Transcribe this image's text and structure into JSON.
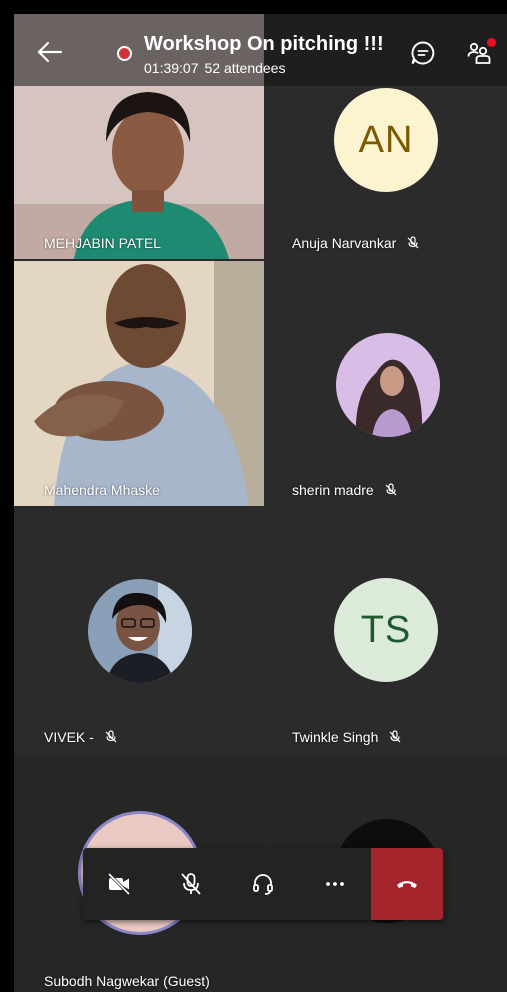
{
  "header": {
    "title": "Workshop On pitching !!!",
    "duration": "01:39:07",
    "attendees": "52 attendees"
  },
  "participants": [
    {
      "name": "MEHJABIN PATEL",
      "type": "video",
      "muted": false
    },
    {
      "name": "Anuja Narvankar",
      "type": "initials",
      "initials": "AN",
      "bg": "#fcf3cf",
      "fg": "#7a5a00",
      "muted": true
    },
    {
      "name": "Mahendra Mhaske",
      "type": "video",
      "muted": false
    },
    {
      "name": "sherin madre",
      "type": "photo",
      "muted": true
    },
    {
      "name": "VIVEK -",
      "type": "photo",
      "muted": true
    },
    {
      "name": "Twinkle  Singh",
      "type": "initials",
      "initials": "TS",
      "bg": "#dcead9",
      "fg": "#1f5a2e",
      "muted": true
    },
    {
      "name": "Subodh Nagwekar (Guest)",
      "type": "photo",
      "muted": false
    }
  ],
  "colors": {
    "recording": "#d13438",
    "hangup": "#a4262c",
    "tile": "#2b2b2b"
  },
  "controls": [
    "camera-off",
    "mic-off",
    "audio-device",
    "more",
    "hang-up"
  ]
}
